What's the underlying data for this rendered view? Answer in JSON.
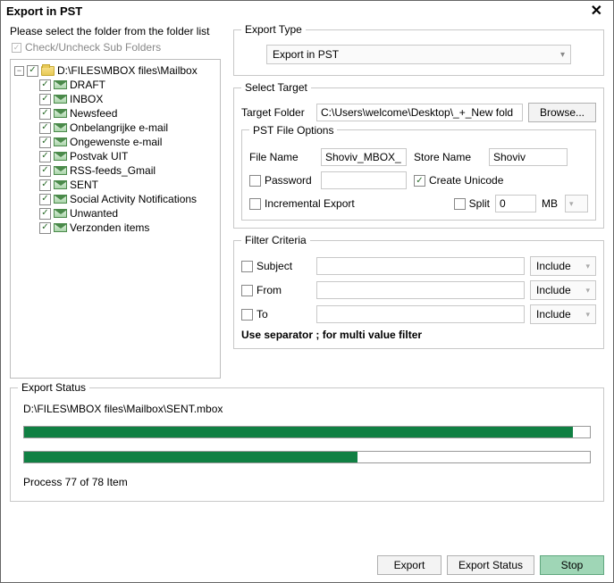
{
  "title": "Export in PST",
  "instruction": "Please select the folder from the folder list",
  "subfolders_label": "Check/Uncheck Sub Folders",
  "tree": {
    "root": "D:\\FILES\\MBOX files\\Mailbox",
    "items": [
      "DRAFT",
      "INBOX",
      "Newsfeed",
      "Onbelangrijke e-mail",
      "Ongewenste e-mail",
      "Postvak UIT",
      "RSS-feeds_Gmail",
      "SENT",
      "Social Activity Notifications",
      "Unwanted",
      "Verzonden items"
    ]
  },
  "export_type": {
    "legend": "Export Type",
    "value": "Export in PST"
  },
  "select_target": {
    "legend": "Select Target",
    "target_label": "Target Folder",
    "target_value": "C:\\Users\\welcome\\Desktop\\_+_New fold",
    "browse": "Browse...",
    "file_opts": {
      "legend": "PST File Options",
      "file_name_label": "File Name",
      "file_name": "Shoviv_MBOX_",
      "store_name_label": "Store Name",
      "store_name": "Shoviv",
      "password_label": "Password",
      "create_unicode_label": "Create Unicode",
      "incremental_label": "Incremental Export",
      "split_label": "Split",
      "split_value": "0",
      "split_unit": "MB"
    }
  },
  "filter": {
    "legend": "Filter Criteria",
    "subject": "Subject",
    "from": "From",
    "to": "To",
    "include": "Include",
    "note": "Use separator ; for multi value filter"
  },
  "status": {
    "legend": "Export Status",
    "path": "D:\\FILES\\MBOX files\\Mailbox\\SENT.mbox",
    "progress1": 97,
    "progress2": 59,
    "process_text": "Process 77 of 78 Item"
  },
  "buttons": {
    "export": "Export",
    "export_status": "Export Status",
    "stop": "Stop"
  }
}
